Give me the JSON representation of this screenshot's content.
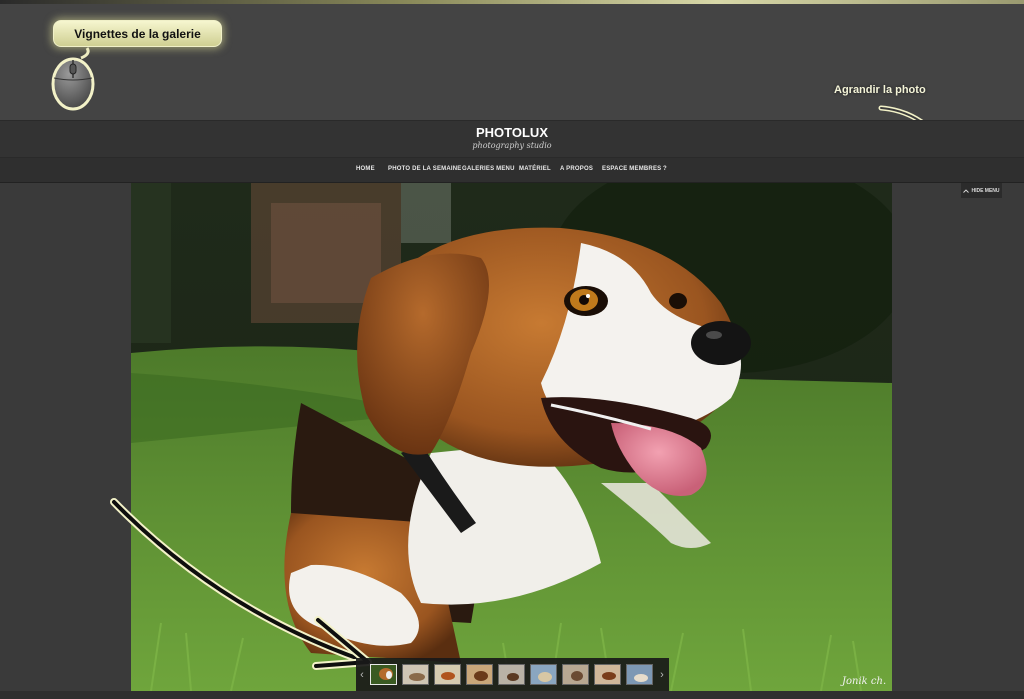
{
  "annotations": {
    "thumbnails_tip": "Vignettes de la galerie",
    "enlarge_tip": "Agrandir la photo"
  },
  "site": {
    "brand": "PHOTOLUX",
    "tagline": "photography studio"
  },
  "nav": {
    "items": [
      {
        "label": "HOME"
      },
      {
        "label": "PHOTO DE LA SEMAINE"
      },
      {
        "label": "GALERIES MENU"
      },
      {
        "label": "MATÉRIEL"
      },
      {
        "label": "A PROPOS"
      },
      {
        "label": "ESPACE MEMBRES"
      },
      {
        "label": "?"
      }
    ],
    "hide_menu_label": "HIDE MENU"
  },
  "photo": {
    "signature": "Jonik ch."
  },
  "thumbnails": {
    "prev_icon": "chevron-left-icon",
    "next_icon": "chevron-right-icon",
    "active_index": 0,
    "count": 9
  },
  "colors": {
    "background": "#3b3b3b",
    "header": "#333333",
    "highlight": "#f0f0c8"
  }
}
